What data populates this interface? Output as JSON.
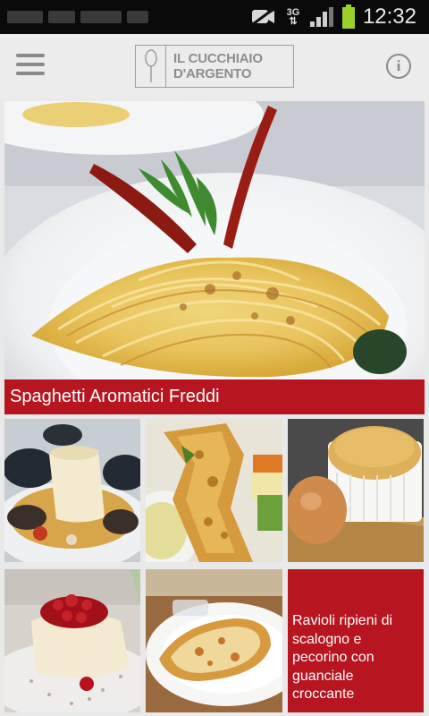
{
  "status_bar": {
    "network": "3G",
    "time": "12:32"
  },
  "app_bar": {
    "brand_line1": "IL CUCCHIAIO",
    "brand_line2": "D'ARGENTO",
    "menu_icon": "hamburger-menu-icon",
    "info_icon": "info-icon",
    "info_glyph": "i"
  },
  "featured": {
    "title": "Spaghetti Aromatici Freddi"
  },
  "grid": {
    "text_tile": "Ravioli ripieni di scalogno e pecorino con guanciale croccante"
  },
  "colors": {
    "accent": "#b7151f",
    "appbar": "#ececec",
    "statusbar": "#0a0a0a"
  }
}
